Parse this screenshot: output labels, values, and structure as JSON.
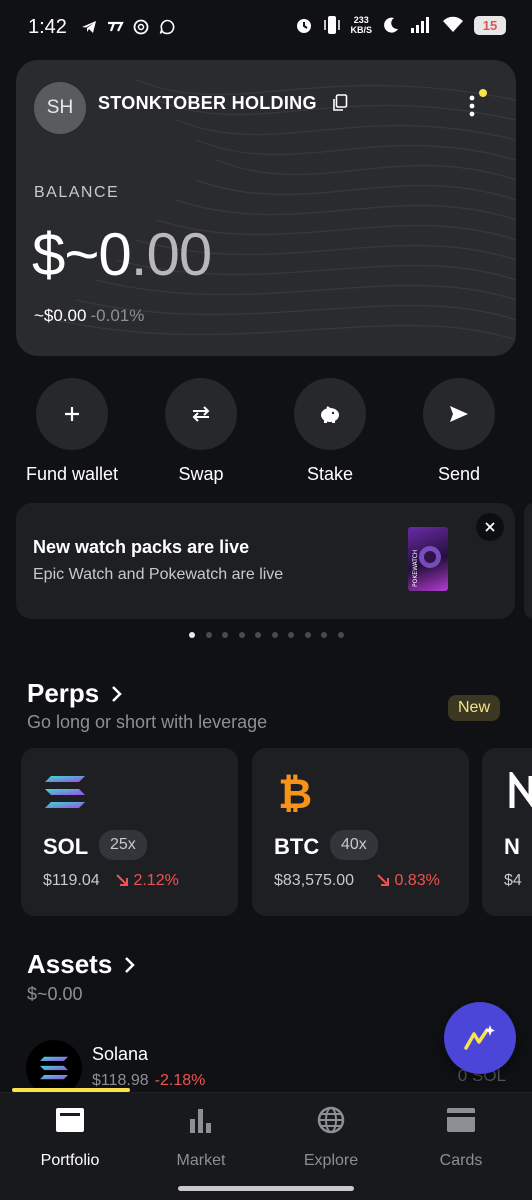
{
  "status_bar": {
    "time": "1:42",
    "net_speed_value": "233",
    "net_speed_unit": "KB/S",
    "battery": "15"
  },
  "account": {
    "initials": "SH",
    "name": "STONKTOBER HOLDING"
  },
  "balance": {
    "label": "BALANCE",
    "amount_main": "$~0",
    "amount_cents": ".00",
    "sub_value": "~$0.00",
    "sub_change": "-0.01%"
  },
  "actions": [
    {
      "label": "Fund wallet",
      "icon": "plus-icon"
    },
    {
      "label": "Swap",
      "icon": "swap-arrows-icon"
    },
    {
      "label": "Stake",
      "icon": "piggy-bank-icon"
    },
    {
      "label": "Send",
      "icon": "send-arrow-icon"
    }
  ],
  "promo": {
    "title": "New watch packs are live",
    "subtitle": "Epic Watch and Pokewatch are live",
    "image_text": "POKEWATCH"
  },
  "carousel": {
    "count": 10,
    "active_index": 0
  },
  "perps": {
    "title": "Perps",
    "subtitle": "Go long or short with leverage",
    "badge": "New",
    "cards": [
      {
        "symbol": "SOL",
        "leverage": "25x",
        "price": "$119.04",
        "change": "2.12%",
        "icon": "solana-icon"
      },
      {
        "symbol": "BTC",
        "leverage": "40x",
        "price": "$83,575.00",
        "change": "0.83%",
        "icon": "bitcoin-icon"
      },
      {
        "symbol": "N",
        "leverage": "",
        "price": "$4",
        "change": "",
        "icon": "near-icon"
      }
    ]
  },
  "assets": {
    "title": "Assets",
    "total": "$~0.00",
    "items": [
      {
        "name": "Solana",
        "price": "$118.98",
        "change": "-2.18%",
        "balance": "0 SOL",
        "icon": "solana-icon"
      }
    ]
  },
  "bottom_nav": [
    {
      "label": "Portfolio",
      "icon": "portfolio-icon",
      "active": true
    },
    {
      "label": "Market",
      "icon": "bar-chart-icon",
      "active": false
    },
    {
      "label": "Explore",
      "icon": "globe-icon",
      "active": false
    },
    {
      "label": "Cards",
      "icon": "card-icon",
      "active": false
    }
  ],
  "colors": {
    "background": "#101114",
    "accent_fab": "#4b45d8",
    "negative": "#ef5350",
    "badge_text": "#f0e58a"
  }
}
